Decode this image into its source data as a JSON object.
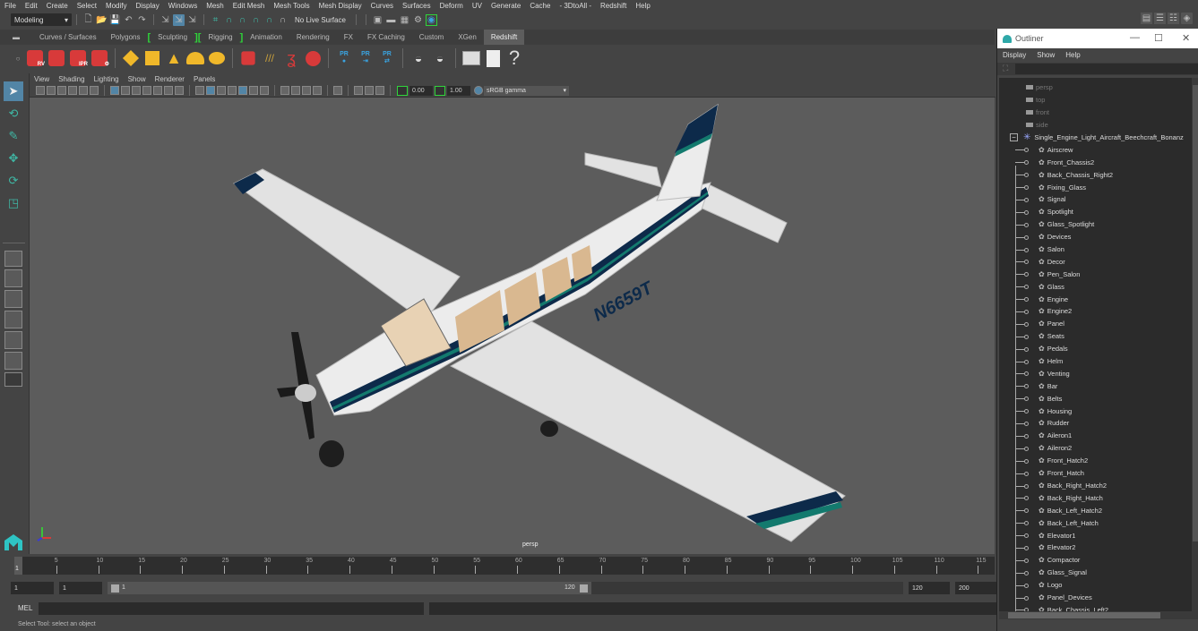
{
  "menubar": {
    "items": [
      "File",
      "Edit",
      "Create",
      "Select",
      "Modify",
      "Display",
      "Windows",
      "Mesh",
      "Edit Mesh",
      "Mesh Tools",
      "Mesh Display",
      "Curves",
      "Surfaces",
      "Deform",
      "UV",
      "Generate",
      "Cache",
      "- 3DtoAll -",
      "Redshift",
      "Help"
    ]
  },
  "statusline": {
    "mode": "Modeling",
    "live_surface": "No Live Surface"
  },
  "shelf": {
    "tabs": [
      "Curves / Surfaces",
      "Polygons",
      "Sculpting",
      "Rigging",
      "Animation",
      "Rendering",
      "FX",
      "FX Caching",
      "Custom",
      "XGen",
      "Redshift"
    ],
    "active_tab": "Redshift",
    "icons": {
      "rv": "RV",
      "ipr": "IPR",
      "pr": "PR",
      "help": "?"
    }
  },
  "viewport": {
    "menu": [
      "View",
      "Shading",
      "Lighting",
      "Show",
      "Renderer",
      "Panels"
    ],
    "exposure": "0.00",
    "gamma": "1.00",
    "color_space": "sRGB gamma",
    "camera_label": "persp",
    "model": {
      "registration": "N6659T",
      "name": "Single Engine Light Aircraft Beechcraft Bonanza"
    },
    "colors": {
      "background": "#5c5c5c",
      "stripe_navy": "#0d2a4a",
      "stripe_teal": "#137a6e",
      "body": "#e8e8e8"
    }
  },
  "timeslider": {
    "ticks": [
      "5",
      "10",
      "15",
      "20",
      "25",
      "30",
      "35",
      "40",
      "45",
      "50",
      "55",
      "60",
      "65",
      "70",
      "75",
      "80",
      "85",
      "90",
      "95",
      "100",
      "105",
      "110",
      "115"
    ],
    "current_frame": "1"
  },
  "range": {
    "start": "1",
    "playback_start": "1",
    "slider_start": "1",
    "slider_end": "120",
    "playback_end": "120",
    "end": "200"
  },
  "mel": {
    "label": "MEL",
    "input": "",
    "output": ""
  },
  "help_line": "Select Tool: select an object",
  "outliner": {
    "title": "Outliner",
    "menu": [
      "Display",
      "Show",
      "Help"
    ],
    "search": "",
    "cameras": [
      "persp",
      "top",
      "front",
      "side"
    ],
    "root": "Single_Engine_Light_Aircraft_Beechcraft_Bonanz",
    "children": [
      "Airscrew",
      "Front_Chassis2",
      "Back_Chassis_Right2",
      "Fixing_Glass",
      "Signal",
      "Spotlight",
      "Glass_Spotlight",
      "Devices",
      "Salon",
      "Decor",
      "Pen_Salon",
      "Glass",
      "Engine",
      "Engine2",
      "Panel",
      "Seats",
      "Pedals",
      "Helm",
      "Venting",
      "Bar",
      "Belts",
      "Housing",
      "Rudder",
      "Aileron1",
      "Aileron2",
      "Front_Hatch2",
      "Front_Hatch",
      "Back_Right_Hatch2",
      "Back_Right_Hatch",
      "Back_Left_Hatch2",
      "Back_Left_Hatch",
      "Elevator1",
      "Elevator2",
      "Compactor",
      "Glass_Signal",
      "Logo",
      "Panel_Devices",
      "Back_Chassis_Left2"
    ]
  }
}
